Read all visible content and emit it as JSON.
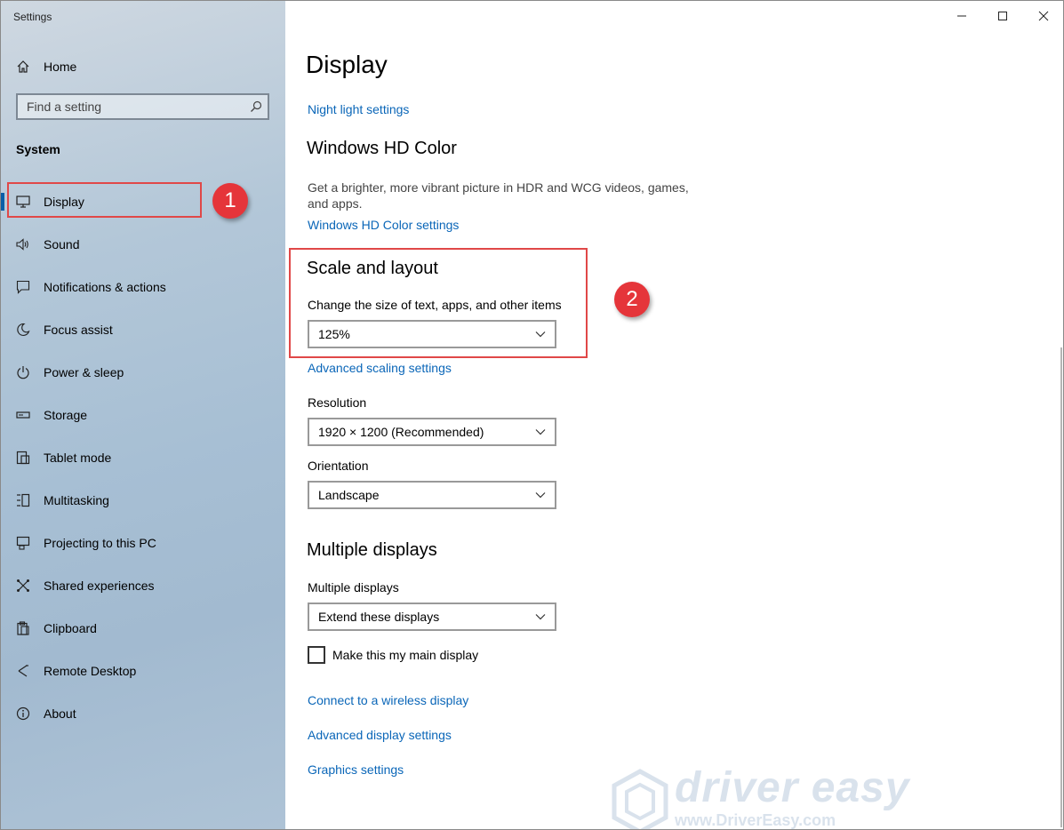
{
  "app": {
    "title": "Settings"
  },
  "sidebar": {
    "home_label": "Home",
    "search_placeholder": "Find a setting",
    "section": "System",
    "items": [
      {
        "label": "Display",
        "icon": "monitor-icon",
        "active": true
      },
      {
        "label": "Sound",
        "icon": "speaker-icon"
      },
      {
        "label": "Notifications & actions",
        "icon": "notification-icon"
      },
      {
        "label": "Focus assist",
        "icon": "moon-icon"
      },
      {
        "label": "Power & sleep",
        "icon": "power-icon"
      },
      {
        "label": "Storage",
        "icon": "storage-icon"
      },
      {
        "label": "Tablet mode",
        "icon": "tablet-icon"
      },
      {
        "label": "Multitasking",
        "icon": "multitasking-icon"
      },
      {
        "label": "Projecting to this PC",
        "icon": "projecting-icon"
      },
      {
        "label": "Shared experiences",
        "icon": "shared-experiences-icon"
      },
      {
        "label": "Clipboard",
        "icon": "clipboard-icon"
      },
      {
        "label": "Remote Desktop",
        "icon": "remote-desktop-icon"
      },
      {
        "label": "About",
        "icon": "info-icon"
      }
    ]
  },
  "annotations": {
    "step1": "1",
    "step2": "2",
    "color": "#e5353a"
  },
  "main": {
    "title": "Display",
    "night_light_link": "Night light settings",
    "hd_color": {
      "heading": "Windows HD Color",
      "description": "Get a brighter, more vibrant picture in HDR and WCG videos, games, and apps.",
      "link": "Windows HD Color settings"
    },
    "scale_layout": {
      "heading": "Scale and layout",
      "scale_label": "Change the size of text, apps, and other items",
      "scale_value": "125%",
      "advanced_link": "Advanced scaling settings",
      "resolution_label": "Resolution",
      "resolution_value": "1920 × 1200 (Recommended)",
      "orientation_label": "Orientation",
      "orientation_value": "Landscape"
    },
    "multiple_displays": {
      "heading": "Multiple displays",
      "label": "Multiple displays",
      "value": "Extend these displays",
      "checkbox_label": "Make this my main display",
      "checkbox_checked": false
    },
    "links": {
      "wireless": "Connect to a wireless display",
      "advanced_display": "Advanced display settings",
      "graphics": "Graphics settings"
    }
  },
  "watermark": {
    "brand": "driver easy",
    "url": "www.DriverEasy.com"
  },
  "colors": {
    "accent": "#0a66b8",
    "callout": "#e04848",
    "sidebar_bg": "#a7bfd4"
  }
}
